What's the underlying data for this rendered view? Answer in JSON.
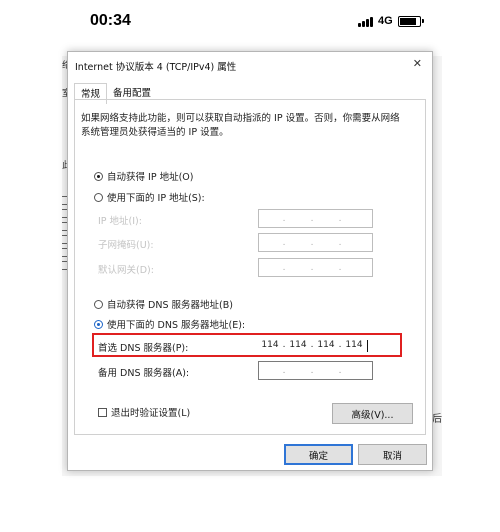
{
  "status_bar": {
    "time": "00:34",
    "network": "4G",
    "signal_icon": "signal-bars-icon",
    "battery_icon": "battery-icon"
  },
  "background": {
    "left_edge_chars": [
      "络",
      "室",
      "此"
    ],
    "right_edge_char": "后"
  },
  "dialog": {
    "title": "Internet 协议版本 4 (TCP/IPv4) 属性",
    "close_icon": "close-icon",
    "tabs": [
      {
        "label": "常规",
        "active": true
      },
      {
        "label": "备用配置",
        "active": false
      }
    ],
    "description": "如果网络支持此功能，则可以获取自动指派的 IP 设置。否则，你需要从网络系统管理员处获得适当的 IP 设置。",
    "ip_section": {
      "auto_label": "自动获得 IP 地址(O)",
      "auto_checked": true,
      "manual_label": "使用下面的 IP 地址(S):",
      "manual_checked": false,
      "fields": [
        {
          "label": "IP 地址(I):",
          "value": [
            "",
            "",
            "",
            ""
          ]
        },
        {
          "label": "子网掩码(U):",
          "value": [
            "",
            "",
            "",
            ""
          ]
        },
        {
          "label": "默认网关(D):",
          "value": [
            "",
            "",
            "",
            ""
          ]
        }
      ]
    },
    "dns_section": {
      "auto_label": "自动获得 DNS 服务器地址(B)",
      "auto_checked": false,
      "manual_label": "使用下面的 DNS 服务器地址(E):",
      "manual_checked": true,
      "preferred_label": "首选 DNS 服务器(P):",
      "preferred_value": [
        "114",
        "114",
        "114",
        "114"
      ],
      "alternate_label": "备用 DNS 服务器(A):",
      "alternate_value": [
        "",
        "",
        "",
        ""
      ]
    },
    "validate_on_exit_label": "退出时验证设置(L)",
    "validate_on_exit_checked": false,
    "advanced_button": "高级(V)...",
    "ok_button": "确定",
    "cancel_button": "取消",
    "highlight_color": "#e02020",
    "accent_color": "#1e66c8"
  }
}
